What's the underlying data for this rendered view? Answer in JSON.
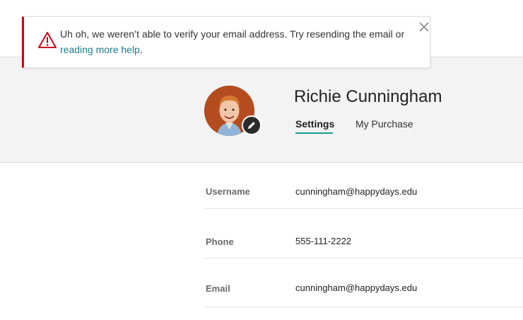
{
  "alert": {
    "message": "Uh oh, we weren’t able to verify your email address. Try resending the email or",
    "link_text": "reading more help",
    "link_suffix": ".",
    "icon": "warning-triangle-icon",
    "close_icon": "close-icon",
    "accent_color": "#d0021b"
  },
  "profile": {
    "name": "Richie Cunningham",
    "avatar_icon": "user-photo",
    "edit_icon": "pencil-icon"
  },
  "tabs": [
    {
      "label": "Settings",
      "active": true
    },
    {
      "label": "My Purchase",
      "active": false
    }
  ],
  "fields": [
    {
      "label": "Username",
      "value": "cunningham@happydays.edu"
    },
    {
      "label": "Phone",
      "value": "555-111-2222"
    },
    {
      "label": "Email",
      "value": "cunningham@happydays.edu"
    }
  ],
  "colors": {
    "accent": "#1a9c8c",
    "link": "#1a7c8c",
    "hero_bg": "#f3f3f3"
  }
}
